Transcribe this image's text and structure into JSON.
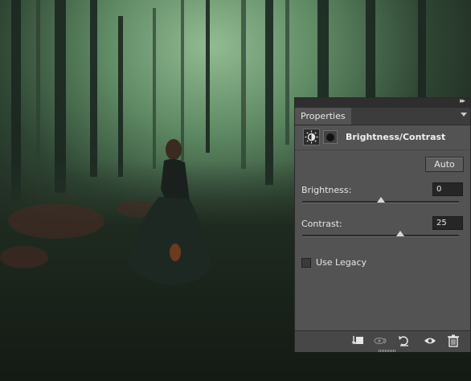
{
  "panel": {
    "tab_label": "Properties",
    "title": "Brightness/Contrast",
    "auto_label": "Auto",
    "brightness": {
      "label": "Brightness:",
      "value": "0",
      "level": 0.5
    },
    "contrast": {
      "label": "Contrast:",
      "value": "25",
      "level": 0.625
    },
    "legacy_label": "Use Legacy",
    "legacy_checked": false
  },
  "icons": {
    "collapse": "double-chevron-right-icon",
    "menu": "panel-menu-icon",
    "adjustment": "brightness-contrast-icon",
    "mask": "layer-mask-icon",
    "clip": "clip-to-layer-icon",
    "view_previous": "view-previous-state-icon",
    "reset": "reset-icon",
    "visibility": "eye-icon",
    "delete": "trash-icon"
  },
  "colors": {
    "panel_bg": "#535353",
    "canvas_fog": "#7fa882",
    "canvas_dark": "#1b211b"
  }
}
